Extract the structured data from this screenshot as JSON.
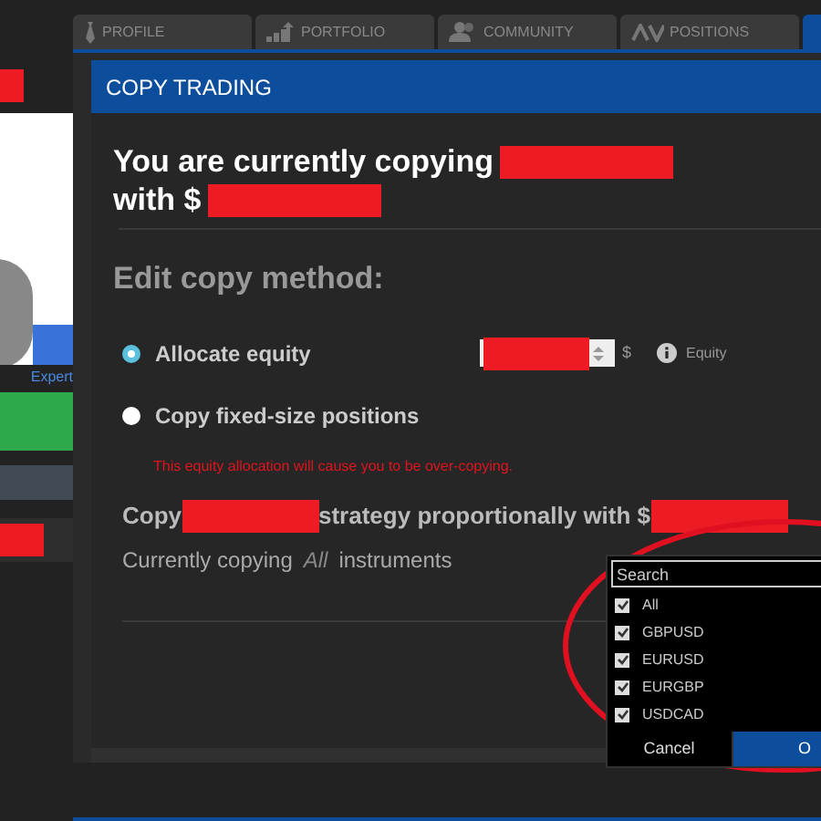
{
  "tabs": [
    {
      "label": "PROFILE",
      "selected": false
    },
    {
      "label": "PORTFOLIO",
      "selected": false
    },
    {
      "label": "COMMUNITY",
      "selected": false
    },
    {
      "label": "POSITIONS",
      "selected": false
    },
    {
      "selected": true
    }
  ],
  "sidebar": {
    "badge": "Expert"
  },
  "panel": {
    "title": "COPY TRADING",
    "heading_lines": [
      [
        {
          "kind": "text",
          "text": "You are currently copying"
        },
        {
          "kind": "redacted"
        }
      ],
      [
        {
          "kind": "text",
          "text": "with $"
        },
        {
          "kind": "redacted"
        }
      ]
    ],
    "section_title": "Edit copy method:",
    "methods": [
      {
        "kind": "equity",
        "label": "Allocate equity",
        "selected": true
      },
      {
        "kind": "fixed",
        "label": "Copy fixed-size positions",
        "selected": false
      }
    ],
    "currency": "$",
    "amount_note": "Equity",
    "warning": "This equity allocation will cause you to be over-copying.",
    "strategy_line": [
      {
        "kind": "text",
        "text": "Copy"
      },
      {
        "kind": "redacted"
      },
      {
        "kind": "text",
        "text": "strategy proportionally with $"
      },
      {
        "kind": "redacted"
      }
    ],
    "instruments_line": {
      "before": "Currently copying",
      "value": "All",
      "after": "instruments"
    }
  },
  "dropdown": {
    "placeholder": "Search",
    "items": [
      {
        "label": "All",
        "checked": true
      },
      {
        "label": "GBPUSD",
        "checked": true
      },
      {
        "label": "EURUSD",
        "checked": true
      },
      {
        "label": "EURGBP",
        "checked": true
      },
      {
        "label": "USDCAD",
        "checked": true
      }
    ],
    "buttons": [
      {
        "label": "Cancel",
        "kind": "secondary"
      },
      {
        "label": "O",
        "kind": "primary"
      }
    ]
  }
}
